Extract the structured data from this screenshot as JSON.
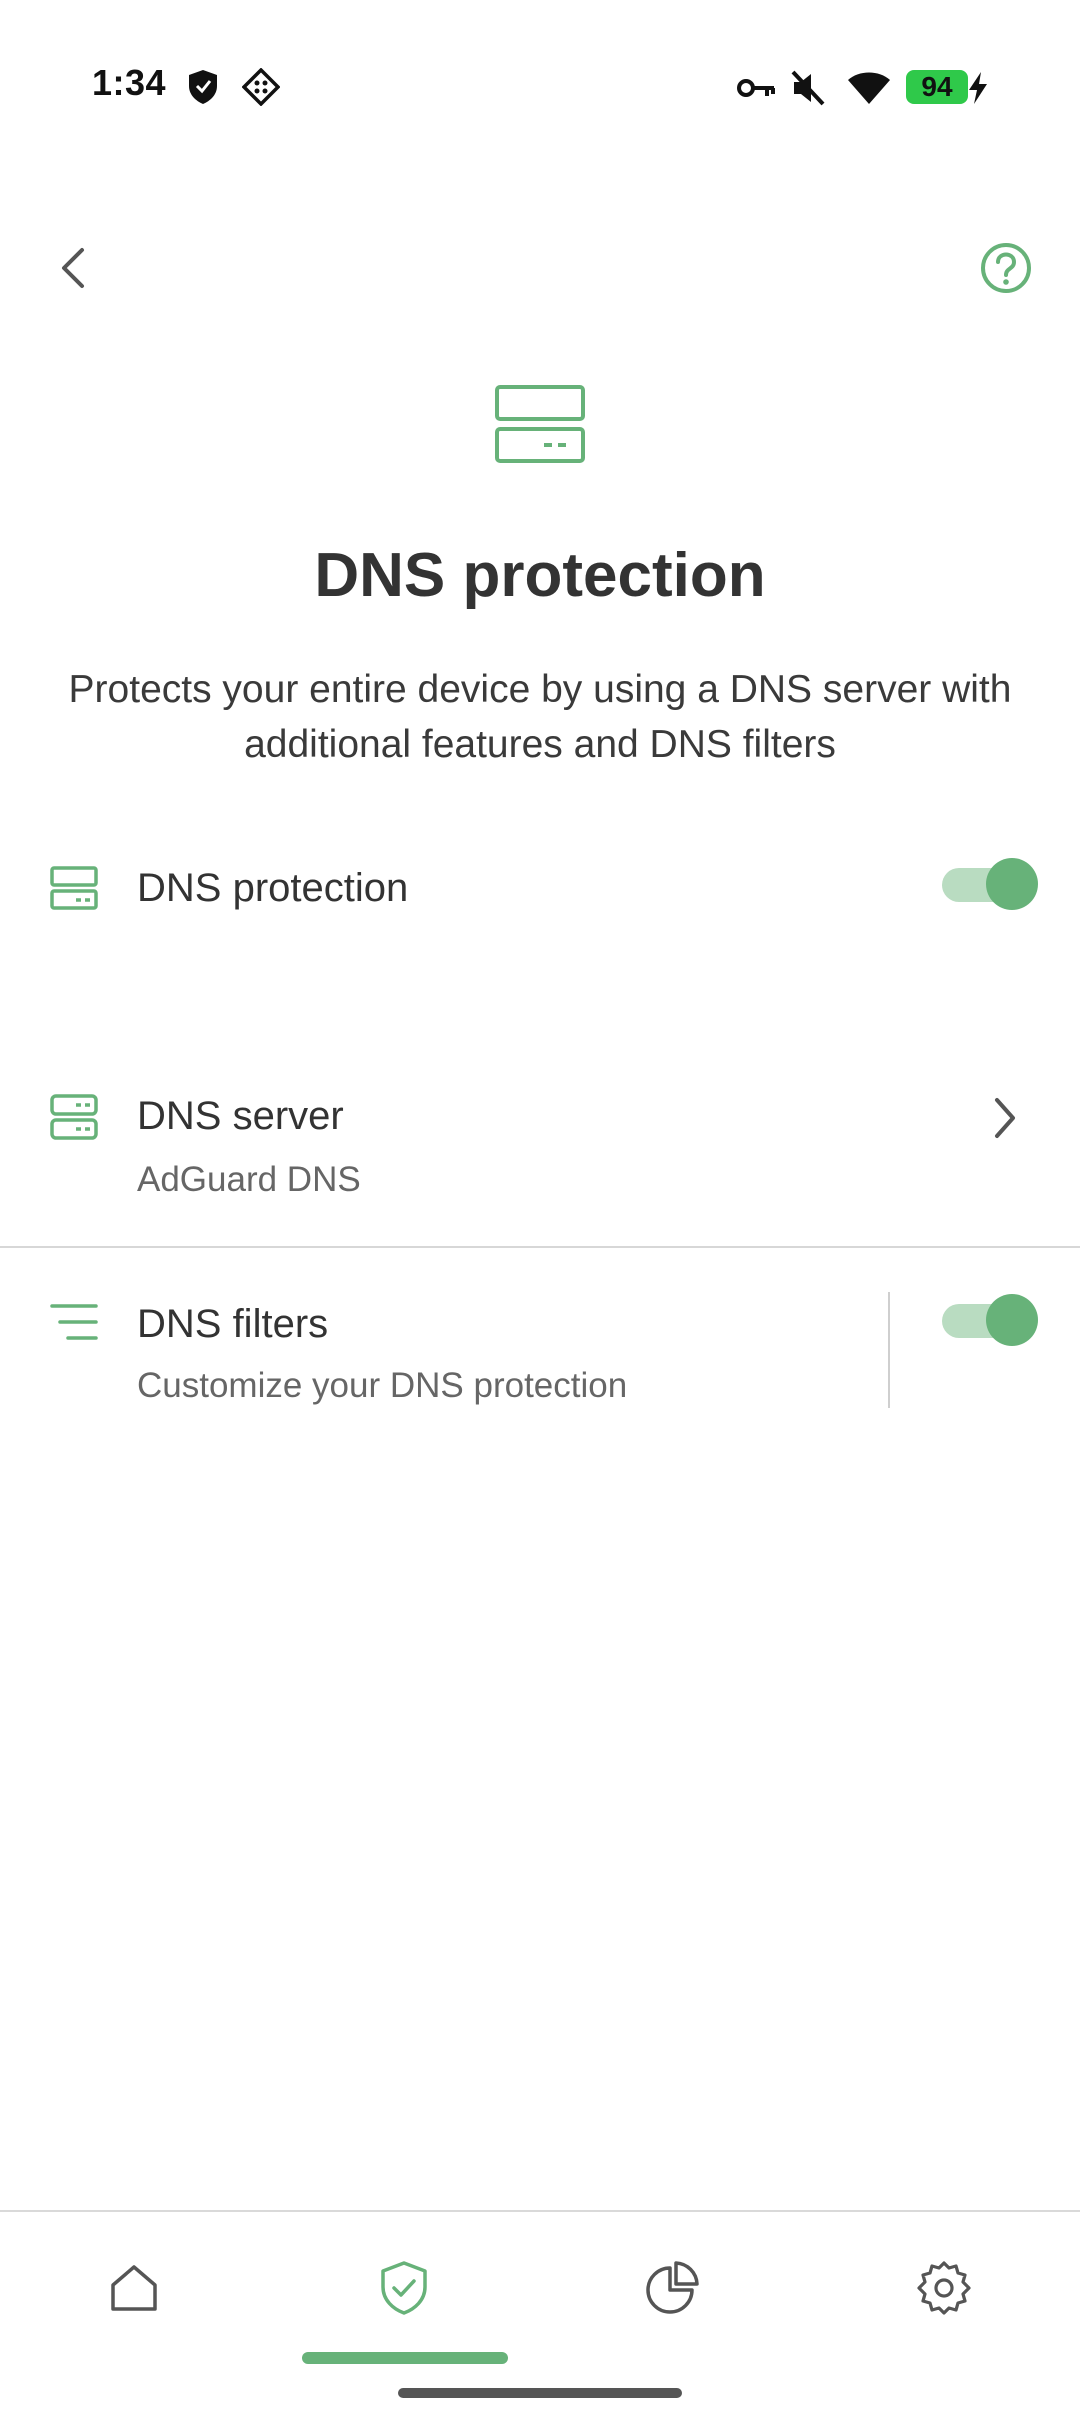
{
  "status_bar": {
    "time": "1:34",
    "battery": "94",
    "icons": [
      "shield-icon",
      "vpn-diamond-icon",
      "key-icon",
      "mute-icon",
      "wifi-icon",
      "battery-icon",
      "charging-icon"
    ]
  },
  "header": {
    "back_icon": "chevron-left-icon",
    "help_icon": "help-circle-icon",
    "hero_icon": "dns-server-icon",
    "title": "DNS protection",
    "description": "Protects your entire device by using a DNS server with additional features and DNS filters"
  },
  "rows": {
    "dns_protection": {
      "label": "DNS protection",
      "enabled": true
    },
    "dns_server": {
      "label": "DNS server",
      "value": "AdGuard DNS"
    },
    "dns_filters": {
      "label": "DNS filters",
      "description": "Customize your DNS protection",
      "enabled": true
    }
  },
  "bottom_nav": {
    "items": [
      "home",
      "protection",
      "statistics",
      "settings"
    ],
    "selected": "protection"
  },
  "colors": {
    "accent": "#67b279",
    "accent_light": "#b9dcc1",
    "text_primary": "#333333",
    "text_secondary": "#666666"
  }
}
